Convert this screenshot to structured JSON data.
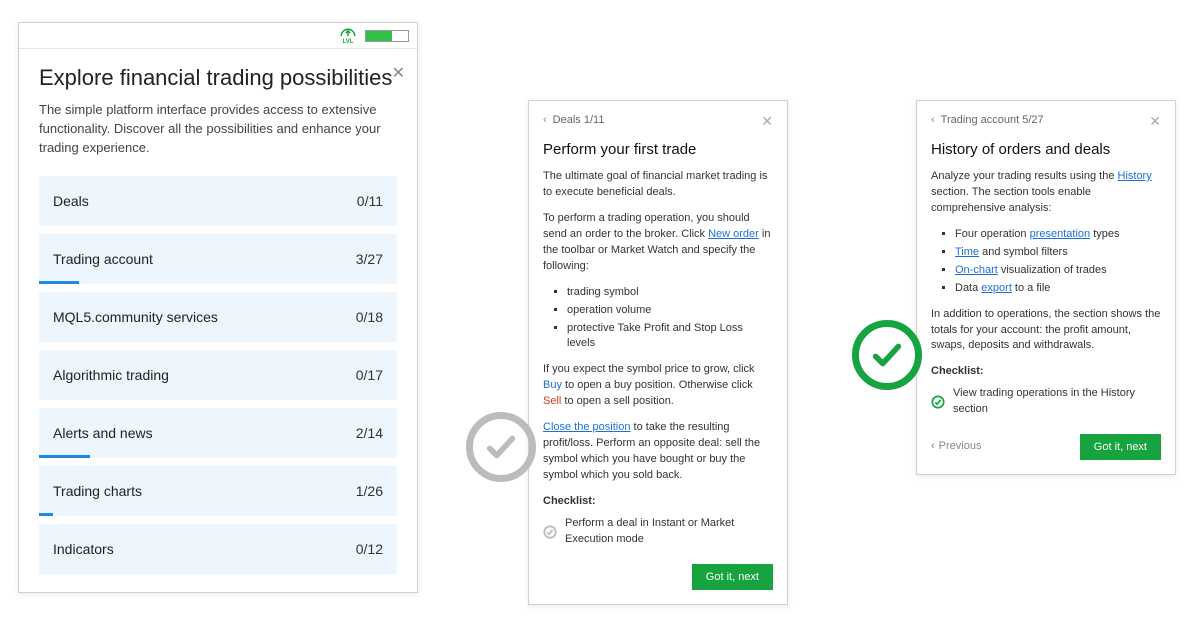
{
  "explore": {
    "title": "Explore financial trading possibilities",
    "subtitle": "The simple platform interface provides access to extensive functionality. Discover all the possibilities and enhance your trading experience.",
    "lvl_label": "LVL",
    "categories": [
      {
        "label": "Deals",
        "done": 0,
        "total": 11
      },
      {
        "label": "Trading account",
        "done": 3,
        "total": 27
      },
      {
        "label": "MQL5.community services",
        "done": 0,
        "total": 18
      },
      {
        "label": "Algorithmic trading",
        "done": 0,
        "total": 17
      },
      {
        "label": "Alerts and news",
        "done": 2,
        "total": 14
      },
      {
        "label": "Trading charts",
        "done": 1,
        "total": 26
      },
      {
        "label": "Indicators",
        "done": 0,
        "total": 12
      }
    ]
  },
  "deals_card": {
    "breadcrumb": "Deals 1/11",
    "title": "Perform your first trade",
    "p1": "The ultimate goal of financial market trading is to execute beneficial deals.",
    "p2a": "To perform a trading operation, you should send an order to the broker. Click ",
    "p2_link": "New order",
    "p2b": " in the toolbar or Market Watch and specify the following:",
    "bullets": [
      "trading symbol",
      "operation volume",
      "protective Take Profit and Stop Loss levels"
    ],
    "p3a": "If you expect the symbol price to grow, click ",
    "p3_buy": "Buy",
    "p3b": " to open a buy position. Otherwise click ",
    "p3_sell": "Sell",
    "p3c": " to open a sell position.",
    "p4_link": "Close the position",
    "p4": " to take the resulting profit/loss. Perform an opposite deal: sell the symbol which you have bought or buy the symbol which you sold back.",
    "checklist_label": "Checklist:",
    "checklist_item": "Perform a deal in Instant or Market Execution mode",
    "next": "Got it, next"
  },
  "history_card": {
    "breadcrumb": "Trading account 5/27",
    "title": "History of orders and deals",
    "p1a": "Analyze your trading results using the ",
    "p1_link": "History",
    "p1b": " section. The section tools enable comprehensive analysis:",
    "bullets_pre": [
      "Four operation ",
      " types"
    ],
    "bullet_links": {
      "presentation": "presentation",
      "time": "Time",
      "onchart": "On-chart",
      "export": "export"
    },
    "bullet2_suffix": " and symbol filters",
    "bullet3_suffix": " visualization of trades",
    "bullet4_prefix": "Data ",
    "bullet4_suffix": " to a file",
    "p2": "In addition to operations, the section shows the totals for your account: the profit amount, swaps, deposits and withdrawals.",
    "checklist_label": "Checklist:",
    "checklist_item": "View trading operations in the History section",
    "prev": "Previous",
    "next": "Got it, next"
  }
}
